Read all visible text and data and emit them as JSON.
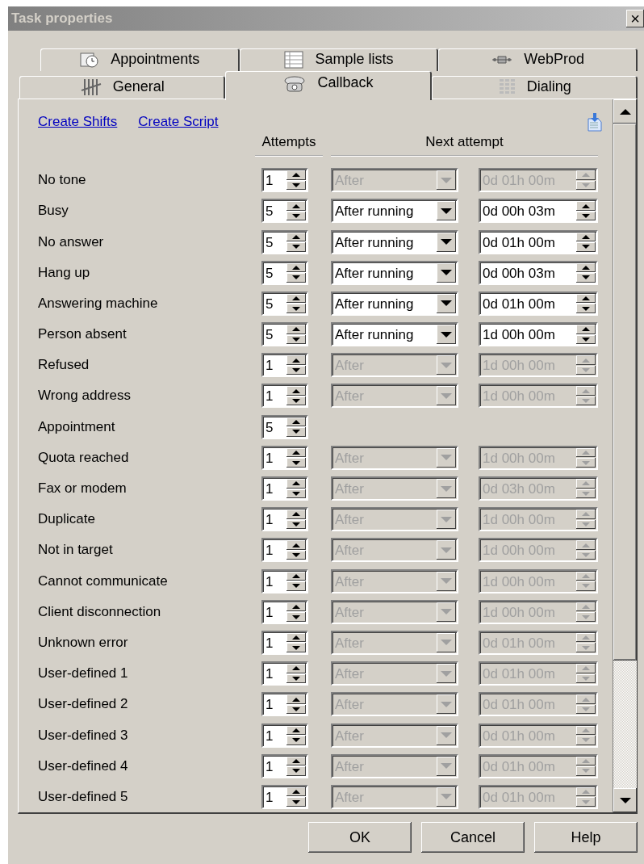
{
  "window": {
    "title": "Task properties",
    "close": "×"
  },
  "tab_rows": [
    [
      {
        "label": "Appointments",
        "selected": false
      },
      {
        "label": "Sample lists",
        "selected": false
      },
      {
        "label": "WebProd",
        "selected": false
      }
    ],
    [
      {
        "label": "General",
        "selected": false
      },
      {
        "label": "Callback",
        "selected": true
      },
      {
        "label": "Dialing",
        "selected": false
      }
    ]
  ],
  "links": [
    "Create Shifts",
    "Create Script"
  ],
  "headers": {
    "attempts": "Attempts",
    "next_attempt": "Next attempt"
  },
  "rows": [
    {
      "label": "No tone",
      "attempts": "1",
      "kind": "full",
      "disabled": true,
      "mode": "After",
      "delay": "0d 01h 00m"
    },
    {
      "label": "Busy",
      "attempts": "5",
      "kind": "full",
      "disabled": false,
      "mode": "After running",
      "delay": "0d 00h 03m"
    },
    {
      "label": "No answer",
      "attempts": "5",
      "kind": "full",
      "disabled": false,
      "mode": "After running",
      "delay": "0d 01h 00m"
    },
    {
      "label": "Hang up",
      "attempts": "5",
      "kind": "full",
      "disabled": false,
      "mode": "After running",
      "delay": "0d 00h 03m"
    },
    {
      "label": "Answering machine",
      "attempts": "5",
      "kind": "full",
      "disabled": false,
      "mode": "After running",
      "delay": "0d 01h 00m"
    },
    {
      "label": "Person absent",
      "attempts": "5",
      "kind": "full",
      "disabled": false,
      "mode": "After running",
      "delay": "1d 00h 00m"
    },
    {
      "label": "Refused",
      "attempts": "1",
      "kind": "full",
      "disabled": true,
      "mode": "After",
      "delay": "1d 00h 00m"
    },
    {
      "label": "Wrong address",
      "attempts": "1",
      "kind": "full",
      "disabled": true,
      "mode": "After",
      "delay": "1d 00h 00m"
    },
    {
      "label": "Appointment",
      "attempts": "5",
      "kind": "attempts_only"
    },
    {
      "label": "Quota reached",
      "attempts": "1",
      "kind": "full",
      "disabled": true,
      "mode": "After",
      "delay": "1d 00h 00m"
    },
    {
      "label": "Fax or modem",
      "attempts": "1",
      "kind": "full",
      "disabled": true,
      "mode": "After",
      "delay": "0d 03h 00m"
    },
    {
      "label": "Duplicate",
      "attempts": "1",
      "kind": "full",
      "disabled": true,
      "mode": "After",
      "delay": "1d 00h 00m"
    },
    {
      "label": "Not in target",
      "attempts": "1",
      "kind": "full",
      "disabled": true,
      "mode": "After",
      "delay": "1d 00h 00m"
    },
    {
      "label": "Cannot communicate",
      "attempts": "1",
      "kind": "full",
      "disabled": true,
      "mode": "After",
      "delay": "1d 00h 00m"
    },
    {
      "label": "Client disconnection",
      "attempts": "1",
      "kind": "full",
      "disabled": true,
      "mode": "After",
      "delay": "1d 00h 00m"
    },
    {
      "label": "Unknown error",
      "attempts": "1",
      "kind": "full",
      "disabled": true,
      "mode": "After",
      "delay": "0d 01h 00m"
    },
    {
      "label": "User-defined 1",
      "attempts": "1",
      "kind": "full",
      "disabled": true,
      "mode": "After",
      "delay": "0d 01h 00m"
    },
    {
      "label": "User-defined 2",
      "attempts": "1",
      "kind": "full",
      "disabled": true,
      "mode": "After",
      "delay": "0d 01h 00m"
    },
    {
      "label": "User-defined 3",
      "attempts": "1",
      "kind": "full",
      "disabled": true,
      "mode": "After",
      "delay": "0d 01h 00m"
    },
    {
      "label": "User-defined 4",
      "attempts": "1",
      "kind": "full",
      "disabled": true,
      "mode": "After",
      "delay": "0d 01h 00m"
    },
    {
      "label": "User-defined 5",
      "attempts": "1",
      "kind": "full",
      "disabled": true,
      "mode": "After",
      "delay": "0d 01h 00m"
    }
  ],
  "buttons": [
    "OK",
    "Cancel",
    "Help"
  ]
}
